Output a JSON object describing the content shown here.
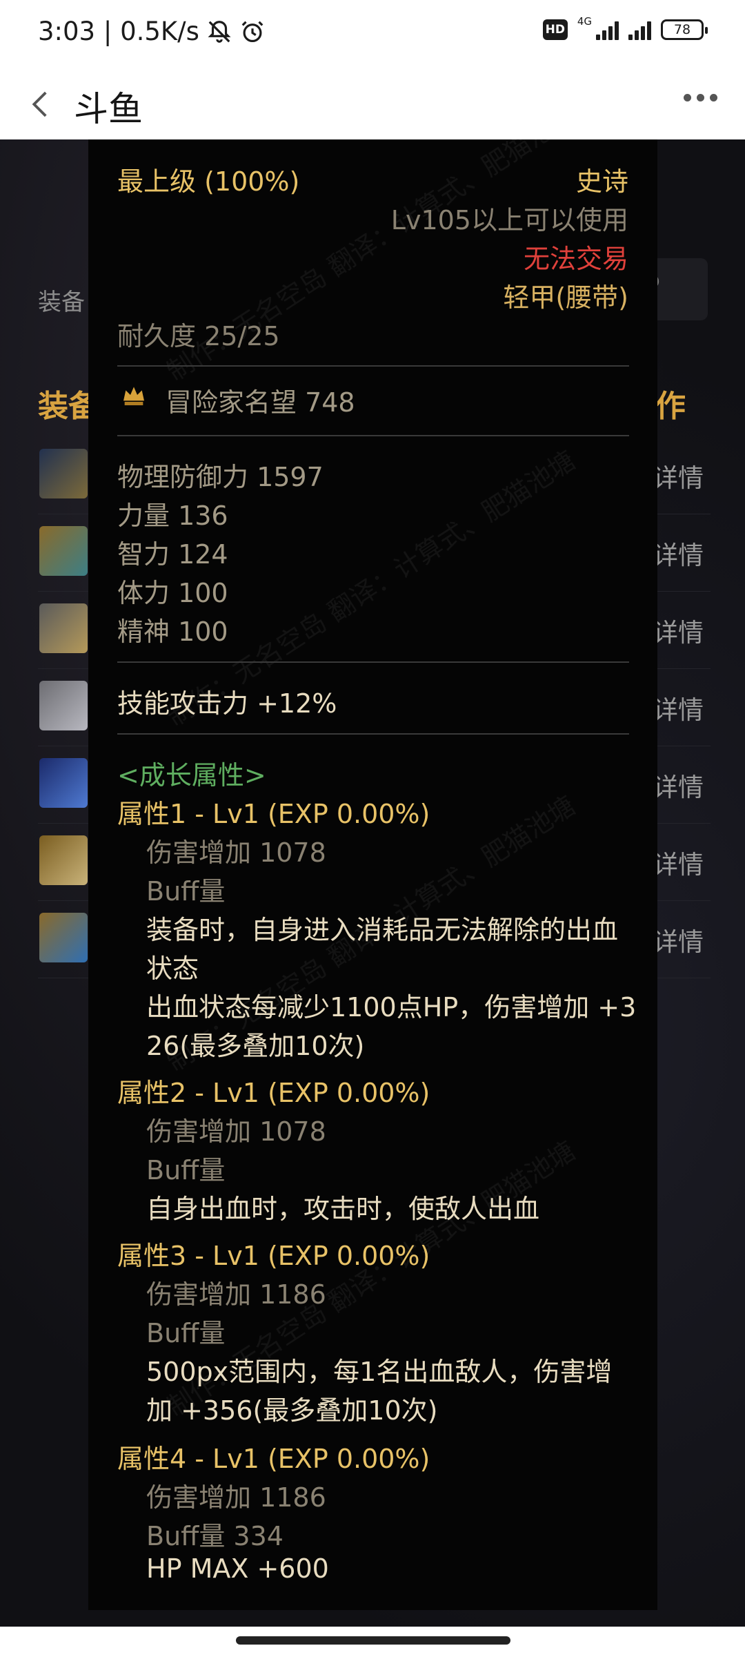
{
  "status_bar": {
    "time_speed": "3:03 | 0.5K/s",
    "hd": "HD",
    "network": "4G",
    "battery": "78"
  },
  "app_bar": {
    "title": "斗鱼"
  },
  "background": {
    "search_label": "装备",
    "equip_title": "装备",
    "work_title": "作",
    "detail_label": "详情",
    "rows": 7
  },
  "tooltip": {
    "grade": "最上级 (100%)",
    "rarity": "史诗",
    "level_req": "Lv105以上可以使用",
    "trade": "无法交易",
    "type": "轻甲(腰带)",
    "durability": "耐久度 25/25",
    "fame": "冒险家名望 748",
    "stats": [
      "物理防御力  1597",
      "力量  136",
      "智力  124",
      "体力  100",
      "精神  100"
    ],
    "skill_attack": "技能攻击力  +12%",
    "growth_header": "<成长属性>",
    "attr1": {
      "title": "属性1 - Lv1 (EXP 0.00%)",
      "dmg": "伤害增加  1078",
      "buff": "Buff量",
      "desc1": "装备时，自身进入消耗品无法解除的出血",
      "desc2": "状态",
      "desc3": "出血状态每减少1100点HP，伤害增加 +3",
      "desc4": "26(最多叠加10次)"
    },
    "attr2": {
      "title": "属性2 - Lv1 (EXP 0.00%)",
      "dmg": "伤害增加  1078",
      "buff": "Buff量",
      "desc1": "自身出血时，攻击时，使敌人出血"
    },
    "attr3": {
      "title": "属性3 - Lv1 (EXP 0.00%)",
      "dmg": "伤害增加  1186",
      "buff": "Buff量",
      "desc1": "500px范围内，每1名出血敌人，伤害增",
      "desc2": "加 +356(最多叠加10次)"
    },
    "attr4": {
      "title": "属性4 - Lv1 (EXP 0.00%)",
      "dmg": "伤害增加  1186",
      "buff": "Buff量  334",
      "hp": "HP MAX +600"
    },
    "watermark": "制作：无名空岛 翻译：计算式、肥猫池塘"
  }
}
